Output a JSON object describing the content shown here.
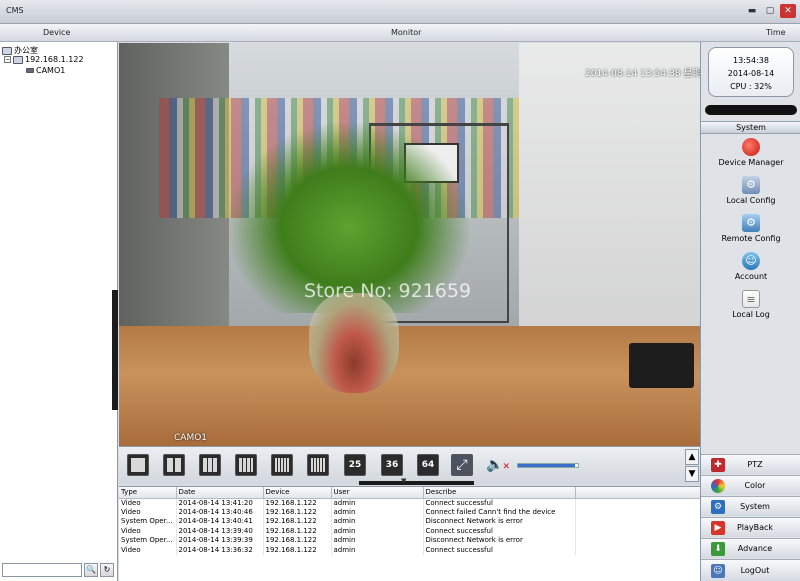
{
  "window": {
    "title": "CMS",
    "minimize": "▬",
    "maximize": "▢",
    "close": "✕"
  },
  "header": {
    "device": "Device",
    "monitor": "Monitor",
    "time": "Time"
  },
  "tree": {
    "root": "办公室",
    "device": "192.168.1.122",
    "camera": "CAMO1",
    "search_icon": "🔍",
    "refresh_icon": "↻"
  },
  "video": {
    "timestamp": "2014-08-14 13:54:38 星期四",
    "camera_label": "CAMO1",
    "watermark": "Store No: 921659"
  },
  "clock": {
    "time": "13:54:38",
    "date": "2014-08-14",
    "cpu": "CPU : 32%"
  },
  "system": {
    "title": "System",
    "items": [
      {
        "label": "Device Manager",
        "icon": "device-manager-icon"
      },
      {
        "label": "Local Config",
        "icon": "local-config-icon"
      },
      {
        "label": "Remote Config",
        "icon": "remote-config-icon"
      },
      {
        "label": "Account",
        "icon": "account-icon"
      },
      {
        "label": "Local Log",
        "icon": "local-log-icon"
      }
    ]
  },
  "menu": [
    {
      "label": "PTZ",
      "icon": "ptz-icon",
      "color": "#c0282d"
    },
    {
      "label": "Color",
      "icon": "color-icon",
      "color": "#2e8b3a"
    },
    {
      "label": "System",
      "icon": "system-icon",
      "color": "#2f6fbf"
    },
    {
      "label": "PlayBack",
      "icon": "playback-icon",
      "color": "#d8352a"
    },
    {
      "label": "Advance",
      "icon": "advance-icon",
      "color": "#3a9a3a"
    },
    {
      "label": "LogOut",
      "icon": "logout-icon",
      "color": "#4a78b8"
    }
  ],
  "toolbar": {
    "layouts": [
      "1",
      "4",
      "9",
      "16",
      "16b",
      "16c"
    ],
    "num25": "25",
    "num36": "36",
    "num64": "64",
    "volume_level": 0.95
  },
  "log": {
    "columns": [
      "Type",
      "Date",
      "Device",
      "User",
      "Describe"
    ],
    "rows": [
      [
        "Video",
        "2014-08-14 13:41:20",
        "192.168.1.122",
        "admin",
        "Connect successful"
      ],
      [
        "Video",
        "2014-08-14 13:40:46",
        "192.168.1.122",
        "admin",
        "Connect failed Cann't find the device"
      ],
      [
        "System Oper...",
        "2014-08-14 13:40:41",
        "192.168.1.122",
        "admin",
        "Disconnect Network is error"
      ],
      [
        "Video",
        "2014-08-14 13:39:40",
        "192.168.1.122",
        "admin",
        "Connect successful"
      ],
      [
        "System Oper...",
        "2014-08-14 13:39:39",
        "192.168.1.122",
        "admin",
        "Disconnect Network is error"
      ],
      [
        "Video",
        "2014-08-14 13:36:32",
        "192.168.1.122",
        "admin",
        "Connect successful"
      ]
    ]
  }
}
